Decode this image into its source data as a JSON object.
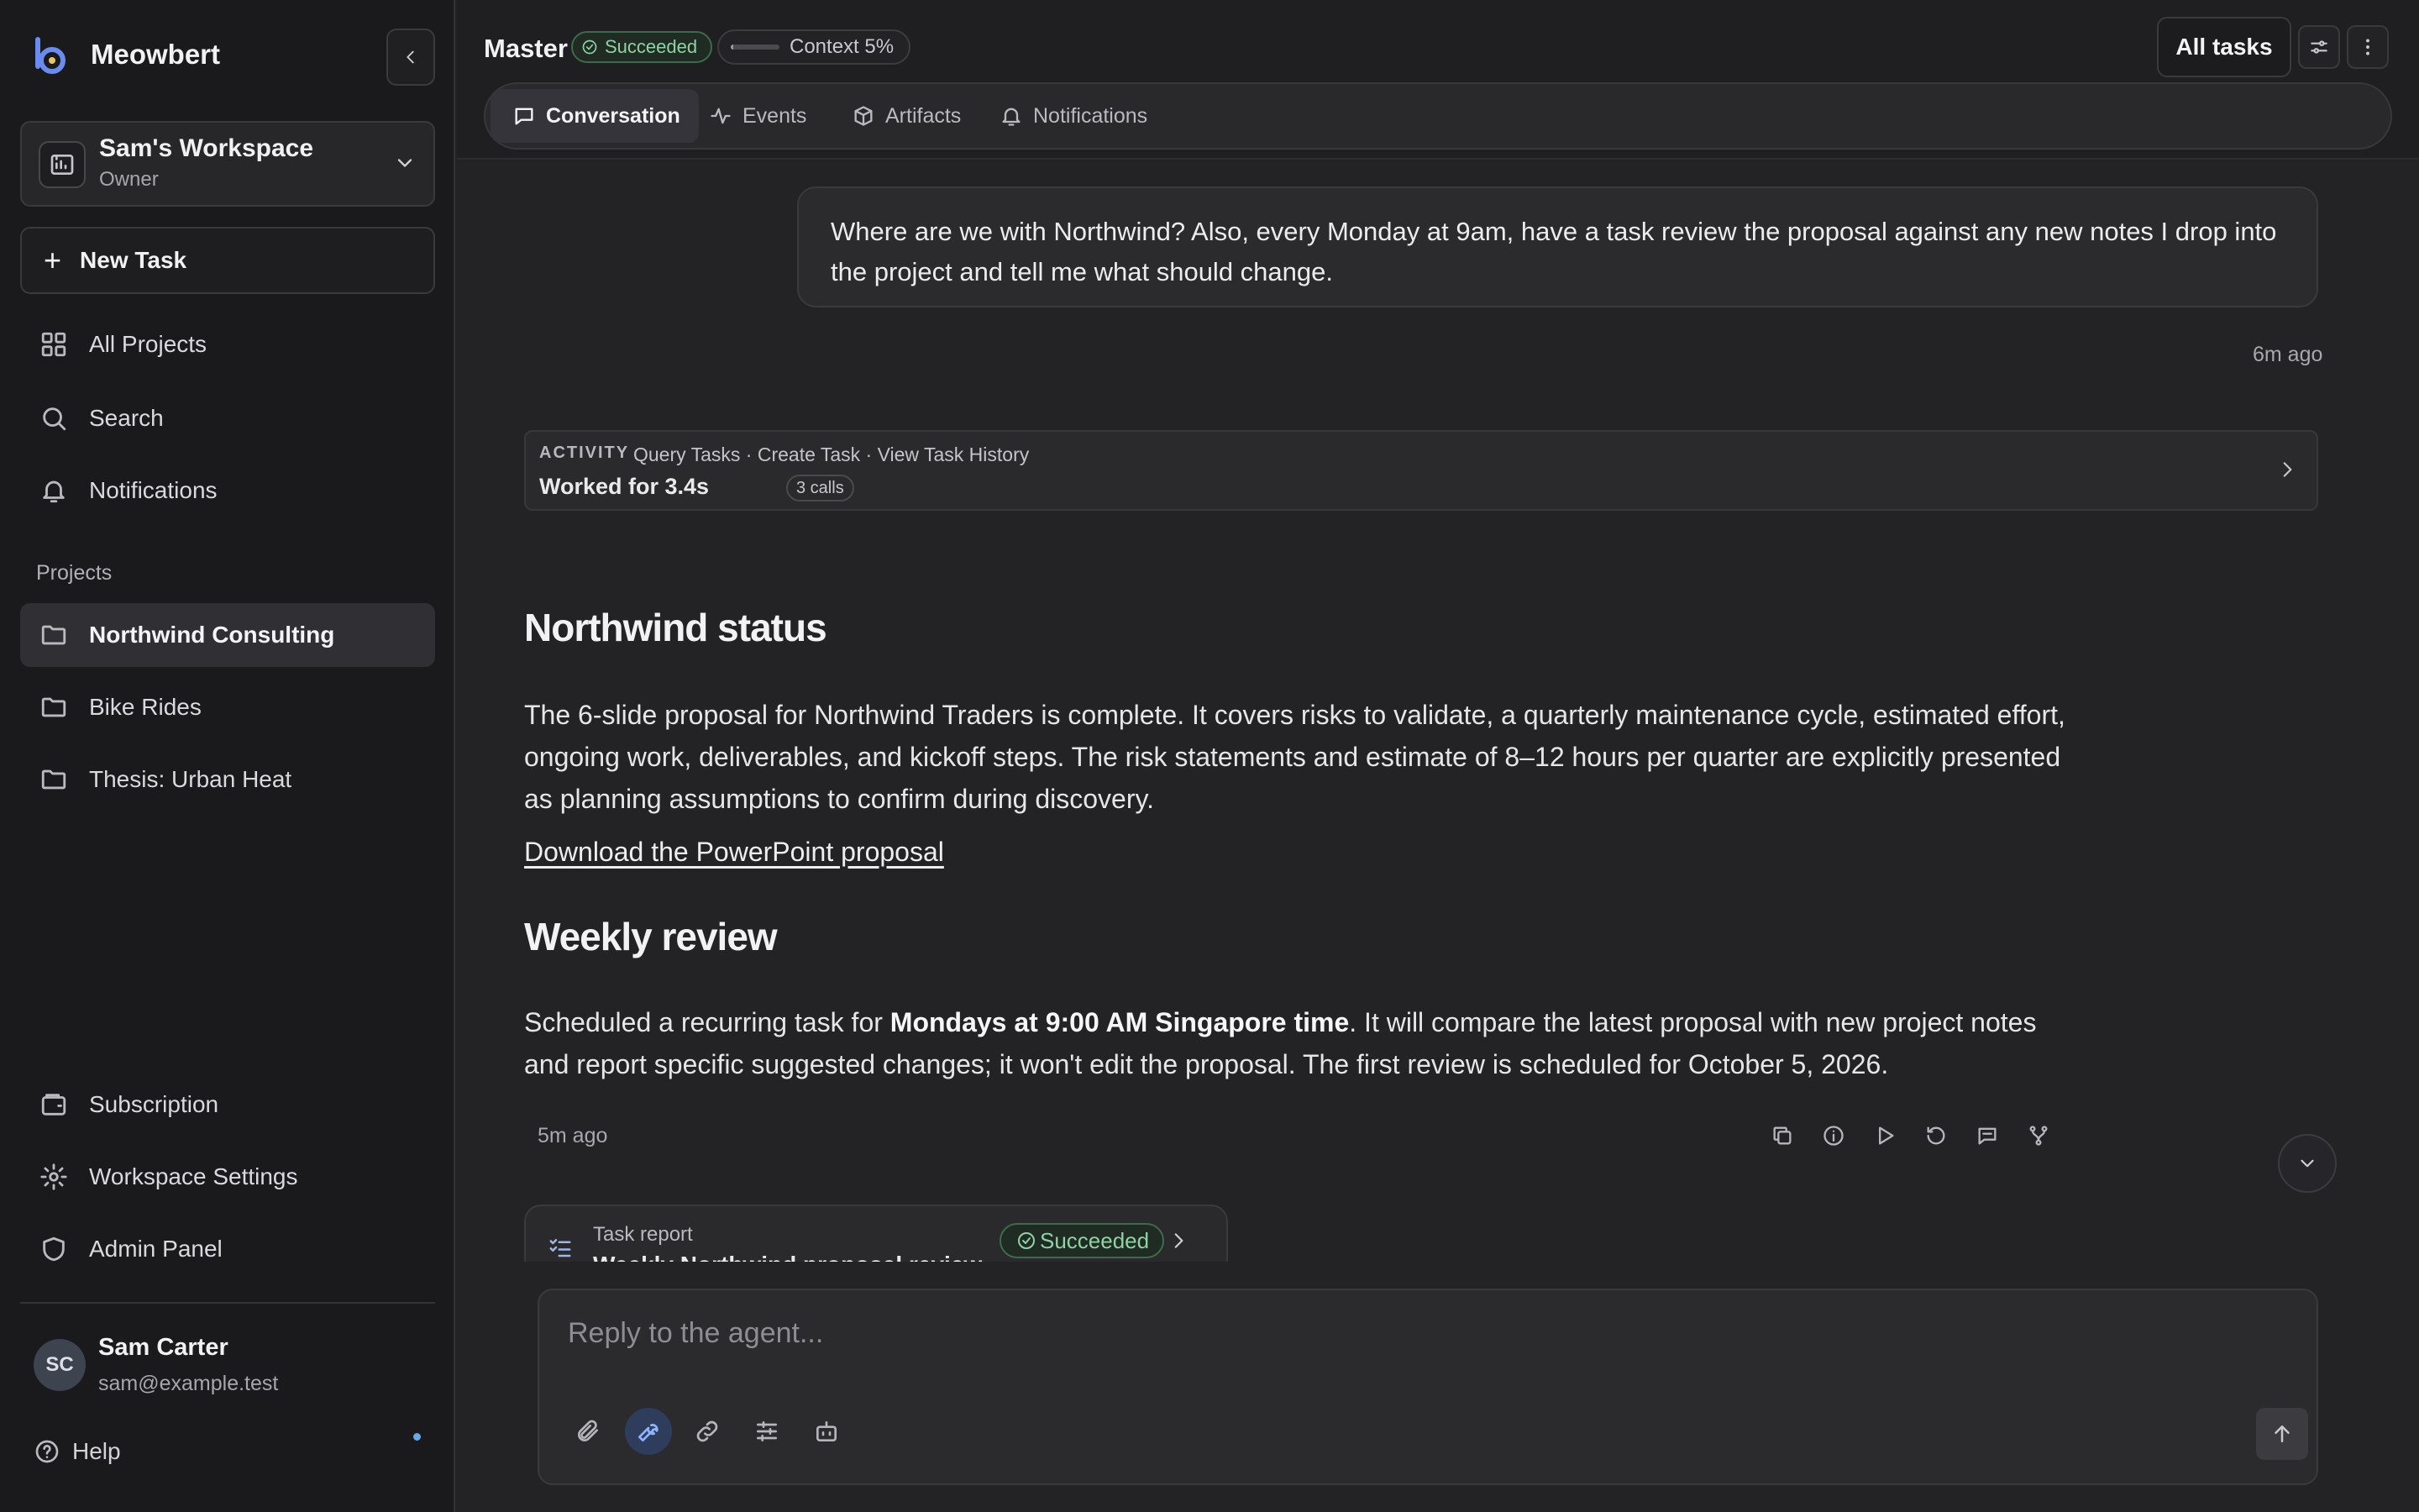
{
  "app": {
    "name": "Meowbert"
  },
  "workspace": {
    "name": "Sam's Workspace",
    "role": "Owner"
  },
  "sidebar": {
    "new_task_label": "New Task",
    "nav": [
      {
        "label": "All Projects",
        "icon": "grid-icon"
      },
      {
        "label": "Search",
        "icon": "search-icon"
      },
      {
        "label": "Notifications",
        "icon": "bell-icon"
      }
    ],
    "projects_heading": "Projects",
    "projects": [
      {
        "label": "Northwind Consulting",
        "active": true
      },
      {
        "label": "Bike Rides",
        "active": false
      },
      {
        "label": "Thesis: Urban Heat",
        "active": false
      }
    ],
    "bottom_nav": [
      {
        "label": "Subscription",
        "icon": "wallet-icon"
      },
      {
        "label": "Workspace Settings",
        "icon": "gear-icon"
      },
      {
        "label": "Admin Panel",
        "icon": "shield-icon"
      }
    ],
    "user": {
      "initials": "SC",
      "name": "Sam Carter",
      "email": "sam@example.test"
    },
    "help_label": "Help"
  },
  "header": {
    "task_title": "Master",
    "status": "Succeeded",
    "context_label": "Context 5%",
    "context_fraction": 0.05,
    "all_tasks_label": "All tasks",
    "tabs": [
      {
        "label": "Conversation",
        "icon": "chat-icon",
        "active": true
      },
      {
        "label": "Events",
        "icon": "activity-icon",
        "active": false
      },
      {
        "label": "Artifacts",
        "icon": "box-icon",
        "active": false
      },
      {
        "label": "Notifications",
        "icon": "bell-icon",
        "active": false
      }
    ]
  },
  "conversation": {
    "user_message": "Where are we with Northwind? Also, every Monday at 9am, have a task review the proposal against any new notes I drop into the project and tell me what should change.",
    "user_message_time": "6m ago",
    "activity": {
      "label": "ACTIVITY",
      "tools": "Query Tasks · Create Task · View Task History",
      "worked": "Worked for 3.4s",
      "calls": "3 calls"
    },
    "response": {
      "heading1": "Northwind status",
      "para1": "The 6-slide proposal for Northwind Traders is complete. It covers risks to validate, a quarterly maintenance cycle, estimated effort, ongoing work, deliverables, and kickoff steps. The risk statements and estimate of 8–12 hours per quarter are explicitly presented as planning assumptions to confirm during discovery.",
      "download_link": "Download the PowerPoint proposal",
      "heading2": "Weekly review",
      "para2_before": "Scheduled a recurring task for ",
      "para2_bold": "Mondays at 9:00 AM Singapore time",
      "para2_after": ". It will compare the latest proposal with new project notes and report specific suggested changes; it won't edit the proposal. The first review is scheduled for October 5, 2026.",
      "time": "5m ago"
    },
    "task_report": {
      "label": "Task report",
      "title": "Weekly Northwind proposal review",
      "status": "Succeeded"
    }
  },
  "composer": {
    "placeholder": "Reply to the agent..."
  },
  "colors": {
    "accent_blue": "#8fb4ff",
    "success_green": "#8fd3a3",
    "background": "#232325",
    "sidebar": "#1a1a1c"
  }
}
